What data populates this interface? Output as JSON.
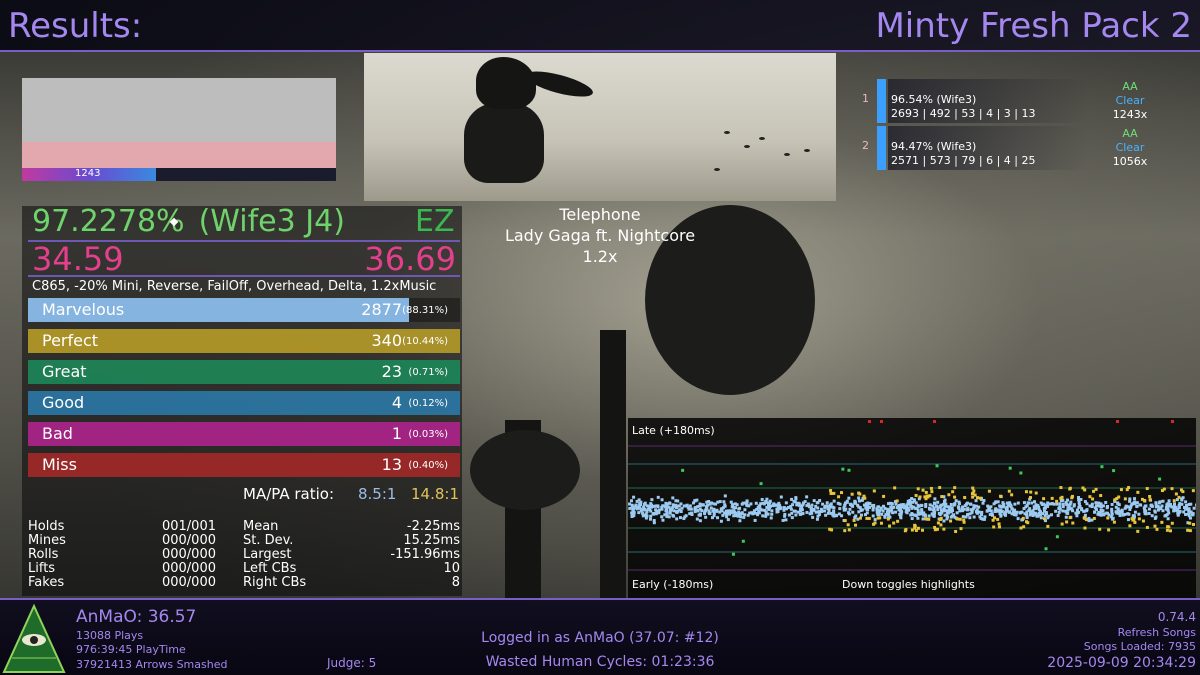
{
  "header": {
    "title": "Results:",
    "pack": "Minty Fresh Pack 2"
  },
  "lifegraph": {
    "label": "1243"
  },
  "song": {
    "title": "Telephone",
    "artist": "Lady Gaga ft. Nightcore",
    "rate": "1.2x"
  },
  "scores": [
    {
      "rank": "1",
      "percent": "96.54% (Wife3)",
      "detail": "2693 | 492 | 53 | 4 | 3 | 13",
      "grade": "AA",
      "clear": "Clear",
      "rate": "1243x"
    },
    {
      "rank": "2",
      "percent": "94.47% (Wife3)",
      "detail": "2571 | 573 | 79 | 6 | 4 | 25",
      "grade": "AA",
      "clear": "Clear",
      "rate": "1056x"
    }
  ],
  "result": {
    "percent": "97.2278%",
    "wife": "(Wife3 J4)",
    "grade": "EZ",
    "msd_left": "34.59",
    "msd_right": "36.69",
    "mods": "C865, -20% Mini, Reverse, FailOff, Overhead, Delta, 1.2xMusic"
  },
  "judgments": [
    {
      "name": "Marvelous",
      "count": "2877",
      "pct": "(88.31%)",
      "fraction": 0.8831,
      "color": "#86b4e0"
    },
    {
      "name": "Perfect",
      "count": "340",
      "pct": "(10.44%)",
      "fraction": 0.1044,
      "color": "#b89d2a"
    },
    {
      "name": "Great",
      "count": "23",
      "pct": "(0.71%)",
      "fraction": 0.0071,
      "color": "#1f8a5a"
    },
    {
      "name": "Good",
      "count": "4",
      "pct": "(0.12%)",
      "fraction": 0.0012,
      "color": "#2c7aa8"
    },
    {
      "name": "Bad",
      "count": "1",
      "pct": "(0.03%)",
      "fraction": 0.0003,
      "color": "#b0258e"
    },
    {
      "name": "Miss",
      "count": "13",
      "pct": "(0.40%)",
      "fraction": 0.004,
      "color": "#a52a2a"
    }
  ],
  "ratio": {
    "label": "MA/PA ratio:",
    "ma": "8.5:1",
    "pa": "14.8:1"
  },
  "notes": [
    {
      "label": "Holds",
      "value": "001/001"
    },
    {
      "label": "Mines",
      "value": "000/000"
    },
    {
      "label": "Rolls",
      "value": "000/000"
    },
    {
      "label": "Lifts",
      "value": "000/000"
    },
    {
      "label": "Fakes",
      "value": "000/000"
    }
  ],
  "timing": [
    {
      "label": "Mean",
      "value": "-2.25ms"
    },
    {
      "label": "St. Dev.",
      "value": "15.25ms"
    },
    {
      "label": "Largest",
      "value": "-151.96ms"
    },
    {
      "label": "Left CBs",
      "value": "10"
    },
    {
      "label": "Right CBs",
      "value": "8"
    }
  ],
  "offset_plot": {
    "late": "Late (+180ms)",
    "early": "Early (-180ms)",
    "hint": "Down toggles highlights"
  },
  "footer": {
    "player": "AnMaO: 36.57",
    "plays": "13088 Plays",
    "playtime": "976:39:45 PlayTime",
    "arrows": "37921413 Arrows Smashed",
    "judge": "Judge: 5",
    "login": "Logged in as AnMaO (37.07: #12)",
    "wasted": "Wasted Human Cycles: 01:23:36",
    "version": "0.74.4",
    "refresh": "Refresh Songs",
    "songs_loaded": "Songs Loaded: 7935",
    "datetime": "2025-09-09 20:34:29"
  }
}
